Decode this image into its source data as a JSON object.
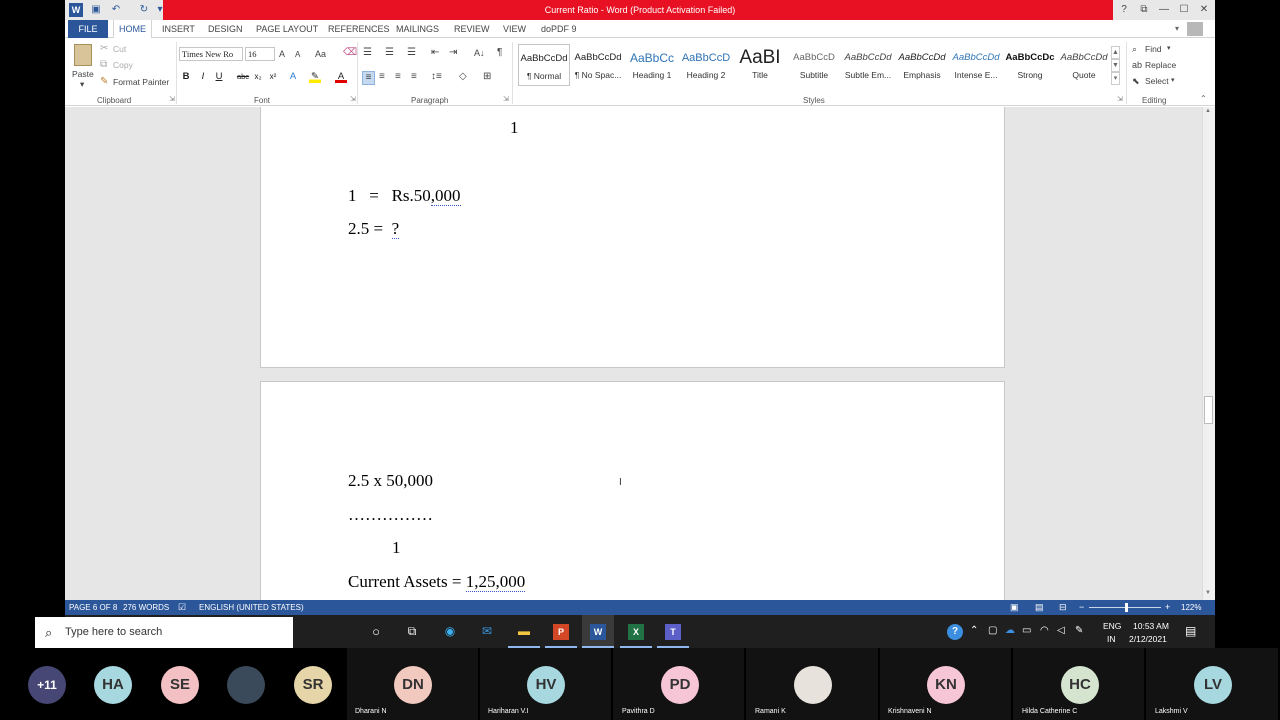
{
  "window": {
    "title": "Current Ratio - Word (Product Activation Failed)",
    "controls": {
      "help": "?",
      "restore_ribbon": "⧉",
      "minimize": "—",
      "maximize": "☐",
      "close": "✕"
    }
  },
  "tabs": {
    "file": "FILE",
    "home": "HOME",
    "insert": "INSERT",
    "design": "DESIGN",
    "page_layout": "PAGE LAYOUT",
    "references": "REFERENCES",
    "mailings": "MAILINGS",
    "review": "REVIEW",
    "view": "VIEW",
    "dopdf": "doPDF 9"
  },
  "clipboard": {
    "paste": "Paste",
    "cut": "Cut",
    "copy": "Copy",
    "format_painter": "Format Painter",
    "group": "Clipboard"
  },
  "font": {
    "name": "Times New Ro",
    "size": "16",
    "group": "Font",
    "bold": "B",
    "italic": "I",
    "underline": "U",
    "strike": "abc",
    "sub": "x₂",
    "sup": "x²",
    "aa": "Aa",
    "grow": "A",
    "shrink": "A",
    "effects": "A",
    "color": "A"
  },
  "paragraph": {
    "group": "Paragraph",
    "sort": "A↓",
    "pilcrow": "¶"
  },
  "styles": {
    "group": "Styles",
    "items": [
      {
        "preview": "AaBbCcDd",
        "name": "¶ Normal"
      },
      {
        "preview": "AaBbCcDd",
        "name": "¶ No Spac..."
      },
      {
        "preview": "AaBbCc",
        "name": "Heading 1"
      },
      {
        "preview": "AaBbCcD",
        "name": "Heading 2"
      },
      {
        "preview": "AaBI",
        "name": "Title"
      },
      {
        "preview": "AaBbCcD",
        "name": "Subtitle"
      },
      {
        "preview": "AaBbCcDd",
        "name": "Subtle Em..."
      },
      {
        "preview": "AaBbCcDd",
        "name": "Emphasis"
      },
      {
        "preview": "AaBbCcDd",
        "name": "Intense E..."
      },
      {
        "preview": "AaBbCcDc",
        "name": "Strong"
      },
      {
        "preview": "AaBbCcDd",
        "name": "Quote"
      }
    ]
  },
  "editing": {
    "find": "Find",
    "replace": "Replace",
    "select": "Select",
    "group": "Editing"
  },
  "document": {
    "page1": {
      "l1": "1",
      "l2a": "1   =   Rs.50",
      "l2b": ",000",
      "l3a": "2.5 =  ",
      "l3b": "?"
    },
    "page2": {
      "l1": "2.5 x 50,000",
      "l2": "……………",
      "l3": "1",
      "l4a": "Current Assets = ",
      "l4b": "1,25,000"
    }
  },
  "status": {
    "page": "PAGE 6 OF 8",
    "words": "276 WORDS",
    "language": "ENGLISH (UNITED STATES)",
    "zoom": "122%"
  },
  "taskbar": {
    "search_placeholder": "Type here to search",
    "lang1": "ENG",
    "lang2": "IN",
    "time": "10:53 AM",
    "date": "2/12/2021"
  },
  "participants": {
    "more": "+11",
    "tiles": [
      {
        "initials": "HA",
        "color": "#a7d8e0",
        "name": ""
      },
      {
        "initials": "SE",
        "color": "#f3c0c4",
        "name": ""
      },
      {
        "initials": "",
        "color": "#3a4a5a",
        "name": ""
      },
      {
        "initials": "SR",
        "color": "#e6d5a8",
        "name": ""
      },
      {
        "initials": "DN",
        "color": "#f2c9bf",
        "name": "Dharani N"
      },
      {
        "initials": "HV",
        "color": "#a7d8e0",
        "name": "Hariharan V.I"
      },
      {
        "initials": "PD",
        "color": "#f6c5d6",
        "name": "Pavithra D"
      },
      {
        "initials": "",
        "color": "#e8e2dc",
        "name": "Ramani K"
      },
      {
        "initials": "KN",
        "color": "#f6c5d6",
        "name": "Krishnaveni N"
      },
      {
        "initials": "HC",
        "color": "#d5e4cf",
        "name": "Hilda Catherine C"
      },
      {
        "initials": "LV",
        "color": "#a7d8e0",
        "name": "Lakshmi V"
      }
    ]
  }
}
